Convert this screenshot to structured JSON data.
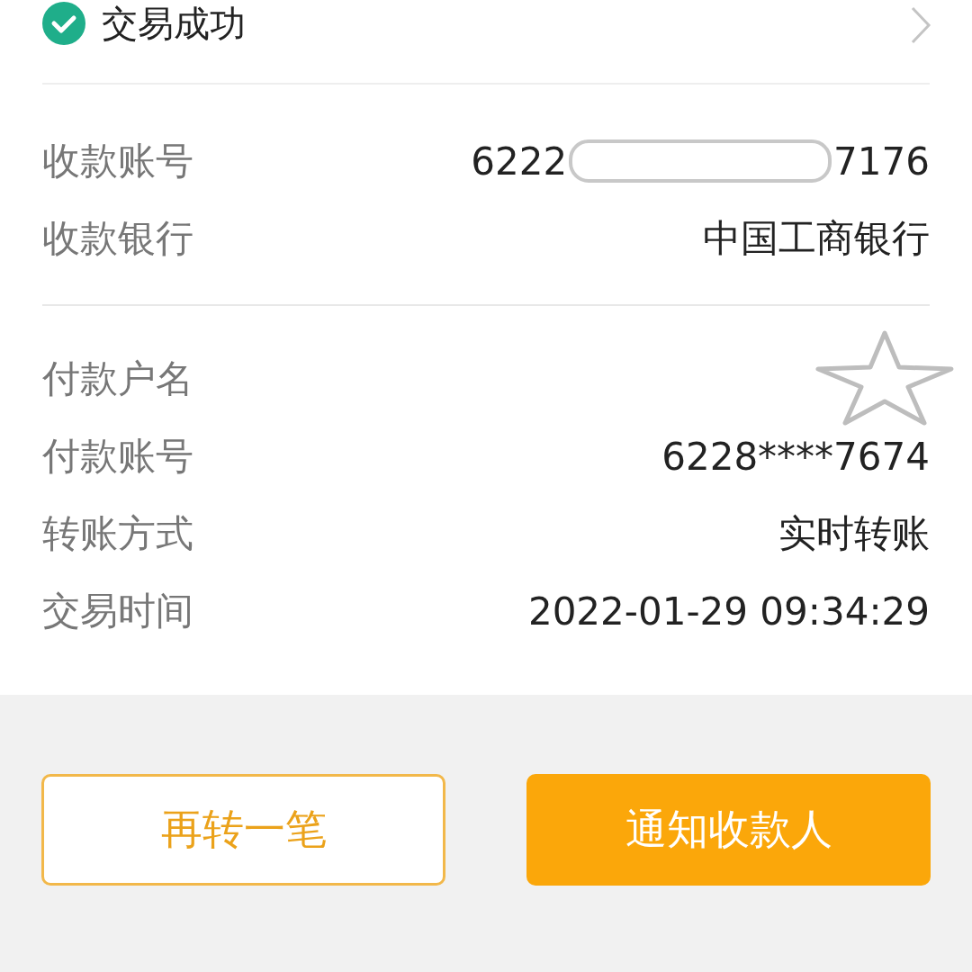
{
  "status": {
    "label": "交易成功",
    "success": true
  },
  "sections": [
    {
      "rows": [
        {
          "kind": "masked",
          "label": "收款账号",
          "prefix": "6222",
          "suffix": "7176"
        },
        {
          "kind": "text",
          "label": "收款银行",
          "value": "中国工商银行"
        }
      ]
    },
    {
      "rows": [
        {
          "kind": "hidden",
          "label": "付款户名"
        },
        {
          "kind": "text",
          "label": "付款账号",
          "value": "6228****7674"
        },
        {
          "kind": "text",
          "label": "转账方式",
          "value": "实时转账"
        },
        {
          "kind": "text",
          "label": "交易时间",
          "value": "2022-01-29 09:34:29"
        }
      ]
    }
  ],
  "buttons": [
    {
      "label": "再转一笔",
      "kind": "outline"
    },
    {
      "label": "通知收款人",
      "kind": "primary"
    }
  ]
}
